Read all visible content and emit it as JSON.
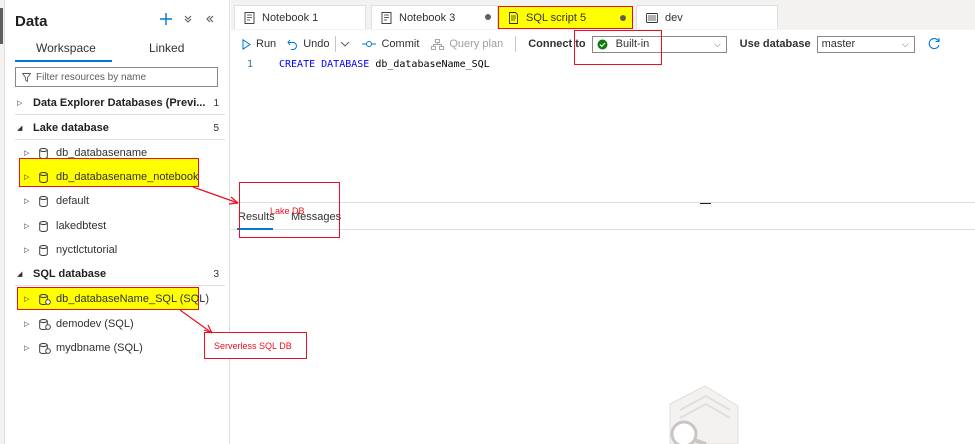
{
  "data_pane": {
    "title": "Data",
    "tabs": [
      "Workspace",
      "Linked"
    ],
    "filter_placeholder": "Filter resources by name",
    "sections": [
      {
        "label": "Data Explorer Databases (Previ...",
        "count": "1"
      },
      {
        "label": "Lake database",
        "count": "5"
      },
      {
        "label": "SQL database",
        "count": "3"
      }
    ],
    "lake_items": [
      "db_databasename",
      "db_databasename_notebook",
      "default",
      "lakedbtest",
      "nyctlctutorial"
    ],
    "sql_items": [
      "db_databaseName_SQL (SQL)",
      "demodev (SQL)",
      "mydbname (SQL)"
    ]
  },
  "tabs": {
    "items": [
      "Notebook 1",
      "Notebook 3",
      "SQL script 5",
      "dev"
    ],
    "active": "SQL script 5"
  },
  "toolbar": {
    "run": "Run",
    "undo": "Undo",
    "commit": "Commit",
    "query_plan": "Query plan",
    "connect_to_label": "Connect to",
    "connect_to_value": "Built-in",
    "use_database_label": "Use database",
    "use_database_value": "master"
  },
  "editor": {
    "line_number": "1",
    "keyword": "CREATE DATABASE",
    "identifier": "db_databaseName_SQL"
  },
  "results": {
    "tabs": [
      "Results",
      "Messages"
    ]
  },
  "annotations": {
    "lake_db": "Lake DB",
    "serverless": "Serverless SQL DB"
  },
  "colors": {
    "accent": "#0078d4",
    "highlight": "#ffff00",
    "annotation": "#e81123",
    "success": "#107c10"
  }
}
